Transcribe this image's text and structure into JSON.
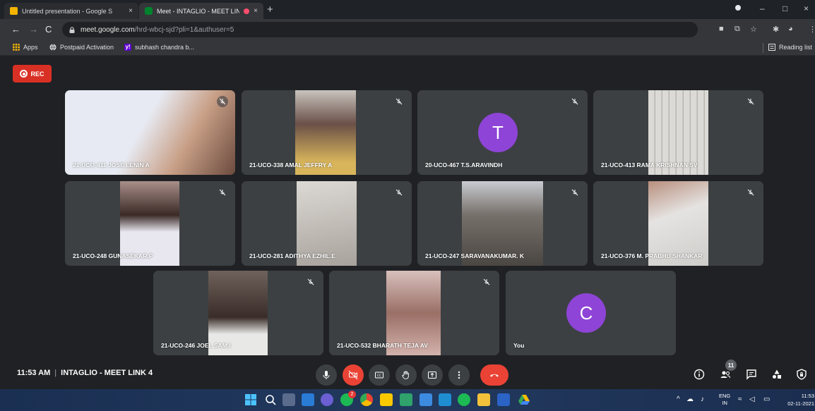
{
  "browser": {
    "tabs": [
      {
        "title": "Untitled presentation - Google S",
        "favicon_color": "#f4b400",
        "active": false
      },
      {
        "title": "Meet - INTAGLIO - MEET LIN",
        "favicon_color": "#00832d",
        "active": true
      }
    ],
    "tab_close": "×",
    "new_tab": "+",
    "window_controls": [
      "–",
      "□",
      "×"
    ],
    "url_host": "meet.google.com",
    "url_path": "/hrd-wbcj-sjd?pli=1&authuser=5",
    "bookmarks": [
      {
        "label": "Apps",
        "icon": "apps-grid-icon",
        "color": "#fbbc04"
      },
      {
        "label": "Postpaid Activation",
        "icon": "globe-icon",
        "color": "#e8eaed"
      },
      {
        "label": "subhash chandra b...",
        "icon": "yahoo-icon",
        "color": "#6001d2"
      }
    ],
    "reading_list": "Reading list"
  },
  "meet": {
    "rec_label": "REC",
    "rec_color": "#d93025",
    "participants": [
      {
        "name": "21-UCO-411 JOSE LENIN A",
        "video": true,
        "bg": "#d8c6c0"
      },
      {
        "name": "21-UCO-338 AMAL JEFFRY A",
        "video": true,
        "bg": "#b9a9a0"
      },
      {
        "name": "20-UCO-467 T.S.ARAVINDH",
        "video": false,
        "initial": "T"
      },
      {
        "name": "21-UCO-413 RAMA KRISHNAN SV",
        "video": true,
        "bg": "#d2d0cc"
      },
      {
        "name": "21-UCO-248 GUNASEKAR.P",
        "video": true,
        "bg": "#c8bdc2"
      },
      {
        "name": "21-UCO-281 ADITHYA EZHIL.E",
        "video": true,
        "bg": "#cfcbc6"
      },
      {
        "name": "21-UCO-247 SARAVANAKUMAR. K",
        "video": true,
        "bg": "#9a9590"
      },
      {
        "name": "21-UCO-376 M. PRABHU SHANKAR",
        "video": true,
        "bg": "#d6d2cf"
      },
      {
        "name": "21-UCO-246 JOEL SAM.I",
        "video": true,
        "bg": "#8f7f78"
      },
      {
        "name": "21-UCO-532 BHARATH TEJA AV",
        "video": true,
        "bg": "#c9a9a4"
      },
      {
        "name": "You",
        "video": false,
        "initial": "C"
      }
    ],
    "avatar_color": "#8e44d6"
  },
  "controls": {
    "time": "11:53 AM",
    "meeting_name": "INTAGLIO - MEET LINK 4",
    "participant_count": "11",
    "hangup_color": "#ea4335"
  },
  "taskbar": {
    "lang_line1": "ENG",
    "lang_line2": "IN",
    "clock_time": "11:53",
    "clock_date": "02-11-2021",
    "spotify_badge": "2"
  }
}
